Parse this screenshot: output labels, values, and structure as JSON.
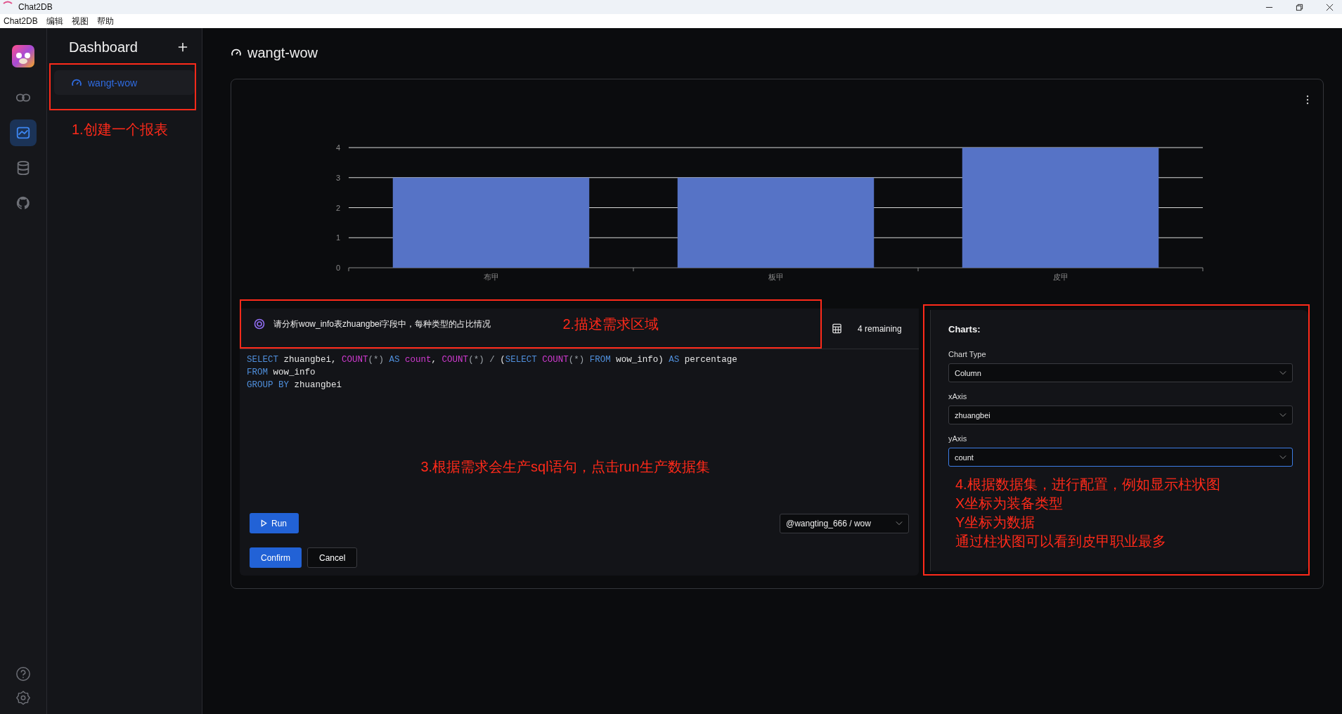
{
  "titlebar": {
    "title": "Chat2DB"
  },
  "menu": [
    "Chat2DB",
    "编辑",
    "视图",
    "帮助"
  ],
  "rail": {
    "items": [
      {
        "selected": false
      },
      {
        "selected": true
      },
      {
        "selected": false
      },
      {
        "selected": false
      }
    ]
  },
  "sidebar": {
    "title": "Dashboard",
    "items": [
      {
        "label": "wangt-wow",
        "selected": true
      }
    ],
    "note": "1.创建一个报表"
  },
  "page": {
    "title": "wangt-wow"
  },
  "chart": {
    "chart_data": {
      "type": "bar",
      "categories": [
        "布甲",
        "板甲",
        "皮甲"
      ],
      "values": [
        3,
        3,
        4
      ],
      "ylim": [
        0,
        4
      ],
      "yticks": [
        0,
        1,
        2,
        3,
        4
      ],
      "grid": true
    }
  },
  "prompt": {
    "text": "请分析wow_info表zhuangbei字段中，每种类型的占比情况",
    "note": "2.描述需求区域",
    "remaining": "4 remaining"
  },
  "sql": {
    "lines": [
      [
        {
          "t": "SELECT",
          "kind": "keyword"
        },
        {
          "t": " zhuangbei, ",
          "kind": "identifier"
        },
        {
          "t": "COUNT",
          "kind": "function"
        },
        {
          "t": "(*) ",
          "kind": "operator"
        },
        {
          "t": "AS",
          "kind": "keyword"
        },
        {
          "t": " count",
          "kind": "function"
        },
        {
          "t": ", ",
          "kind": "identifier"
        },
        {
          "t": "COUNT",
          "kind": "function"
        },
        {
          "t": "(*) / ",
          "kind": "operator"
        },
        {
          "t": "(",
          "kind": "identifier"
        },
        {
          "t": "SELECT",
          "kind": "keyword"
        },
        {
          "t": " COUNT",
          "kind": "function"
        },
        {
          "t": "(*) ",
          "kind": "operator"
        },
        {
          "t": "FROM",
          "kind": "keyword"
        },
        {
          "t": " wow_info) ",
          "kind": "identifier"
        },
        {
          "t": "AS",
          "kind": "keyword"
        },
        {
          "t": " percentage",
          "kind": "identifier"
        }
      ],
      [
        {
          "t": "FROM",
          "kind": "keyword"
        },
        {
          "t": " wow_info",
          "kind": "identifier"
        }
      ],
      [
        {
          "t": "GROUP BY",
          "kind": "keyword"
        },
        {
          "t": " zhuangbei",
          "kind": "identifier"
        }
      ]
    ],
    "note": "3.根据需求会生产sql语句，点击run生产数据集"
  },
  "run_button": "Run",
  "database": "@wangting_666 / wow",
  "buttons": [
    {
      "label": "Confirm",
      "kind": "primary"
    },
    {
      "label": "Cancel",
      "kind": "default"
    }
  ],
  "charts_panel": {
    "title": "Charts:",
    "fields": [
      {
        "label": "Chart Type",
        "value": "Column",
        "focused": false
      },
      {
        "label": "xAxis",
        "value": "zhuangbei",
        "focused": false
      },
      {
        "label": "yAxis",
        "value": "count",
        "focused": true
      }
    ],
    "note_lines": [
      "4.根据数据集，进行配置，例如显示柱状图",
      "X坐标为装备类型",
      "Y坐标为数据",
      "通过柱状图可以看到皮甲职业最多"
    ]
  }
}
